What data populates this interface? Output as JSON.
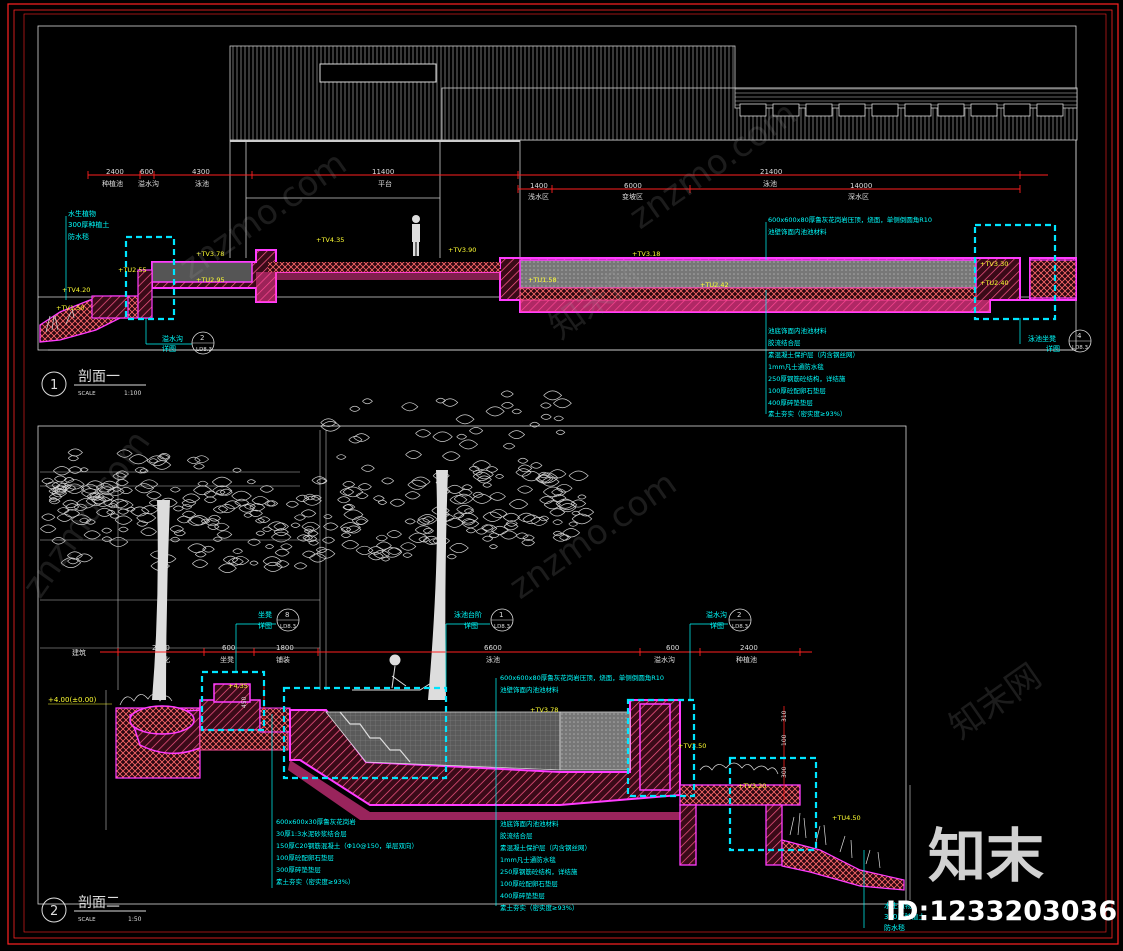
{
  "colors": {
    "background": "#000000",
    "frame": "#ff2222",
    "line": "#d8d8d8",
    "magenta": "#ff3cff",
    "pink": "#ff4f9a",
    "hatch": "#ff6a6a",
    "cyan": "#00e5ff",
    "dim": "#ff2020",
    "yellow": "#ffff33",
    "leader": "#00ffff"
  },
  "section1": {
    "title": "剖面一",
    "number": "1",
    "scale_label": "SCALE",
    "scale_value": "1:100",
    "dims_top": [
      {
        "value": "2400",
        "label": "种植池"
      },
      {
        "value": "600",
        "label": "溢水沟"
      },
      {
        "value": "4300",
        "label": "泳池"
      },
      {
        "value": "11400",
        "label": "平台"
      },
      {
        "value": "21400",
        "label": "泳池"
      }
    ],
    "dims_second": [
      {
        "value": "1400",
        "label": "浅水区"
      },
      {
        "value": "6000",
        "label": "变坡区"
      },
      {
        "value": "14000",
        "label": "深水区"
      }
    ],
    "elevations": [
      "+TV4.20",
      "+TV1.50",
      "+TV3.78",
      "+TV4.35",
      "+TV3.90",
      "+TV3.18",
      "+TU2.95",
      "+TU2.55",
      "+TU1.58",
      "+TU2.42",
      "+TV3.30",
      "+TU2.40"
    ],
    "left_notes": [
      "水生植物",
      "300厚种植土",
      "防水毯"
    ],
    "top_notes": [
      "600x600x80厚鲁灰花岗岩压顶，烧面，单侧倒圆角R10",
      "池壁饰面内池池材料"
    ],
    "bottom_notes": [
      "池底饰面内池池材料",
      "胶流结合层",
      "素混凝土保护层（内含钢丝网）",
      "1mm凡士通防水毯",
      "250厚钢筋砼结构，详结施",
      "100厚砼配卵石垫层",
      "400厚碎垫垫层",
      "素土夯实（密实度≥93%）"
    ],
    "callout_left": {
      "label": "溢水沟",
      "sub": "详图",
      "num": "2",
      "ref": "LD8.3"
    },
    "callout_right": {
      "label": "泳池坐凳",
      "sub": "详图",
      "num": "4",
      "ref": "LD8.3"
    }
  },
  "section2": {
    "title": "剖面二",
    "number": "2",
    "scale_label": "SCALE",
    "scale_value": "1:50",
    "dims_top": [
      {
        "value": "2700",
        "label": "绿化"
      },
      {
        "value": "600",
        "label": "坐凳"
      },
      {
        "value": "1800",
        "label": "铺装"
      },
      {
        "value": "6600",
        "label": "泳池"
      },
      {
        "value": "600",
        "label": "溢水沟"
      },
      {
        "value": "2400",
        "label": "种植池"
      }
    ],
    "left_label": "建筑",
    "left_elev": "+4.00(±0.00)",
    "elevations": [
      "+4.35",
      "+TV3.78",
      "+TV3.50",
      "+TV3.20",
      "+TU4.50"
    ],
    "vertical_dims": [
      "310",
      "100",
      "300",
      "450"
    ],
    "callouts": [
      {
        "label": "坐凳",
        "sub": "详图",
        "num": "8",
        "ref": "LD8.3"
      },
      {
        "label": "泳池台阶",
        "sub": "详图",
        "num": "1",
        "ref": "LD8.3"
      },
      {
        "label": "溢水沟",
        "sub": "详图",
        "num": "2",
        "ref": "LD8.3"
      }
    ],
    "left_notes": [
      "600x600x30厚鲁灰花岗岩",
      "30厚1:3水泥砂浆结合层",
      "150厚C20钢筋混凝土（Φ10@150，单层双向）",
      "100厚砼配卵石垫层",
      "300厚碎垫垫层",
      "素土夯实（密实度≥93%）"
    ],
    "top_notes": [
      "600x600x80厚鲁灰花岗岩压顶，烧面，单侧倒圆角R10",
      "池壁饰面内池池材料"
    ],
    "bottom_notes": [
      "池底饰面内池池材料",
      "胶流结合层",
      "素混凝土保护层（内含钢丝网）",
      "1mm凡士通防水毯",
      "250厚钢筋砼结构，详结施",
      "100厚砼配卵石垫层",
      "400厚碎垫垫层",
      "素土夯实（密实度≥93%）"
    ],
    "right_notes": [
      "水生植物",
      "300厚种植土",
      "防水毯"
    ]
  },
  "watermark": {
    "logo": "知末",
    "id_text": "ID:1233203036",
    "site": "znzmo.com",
    "brand": "知末网"
  }
}
